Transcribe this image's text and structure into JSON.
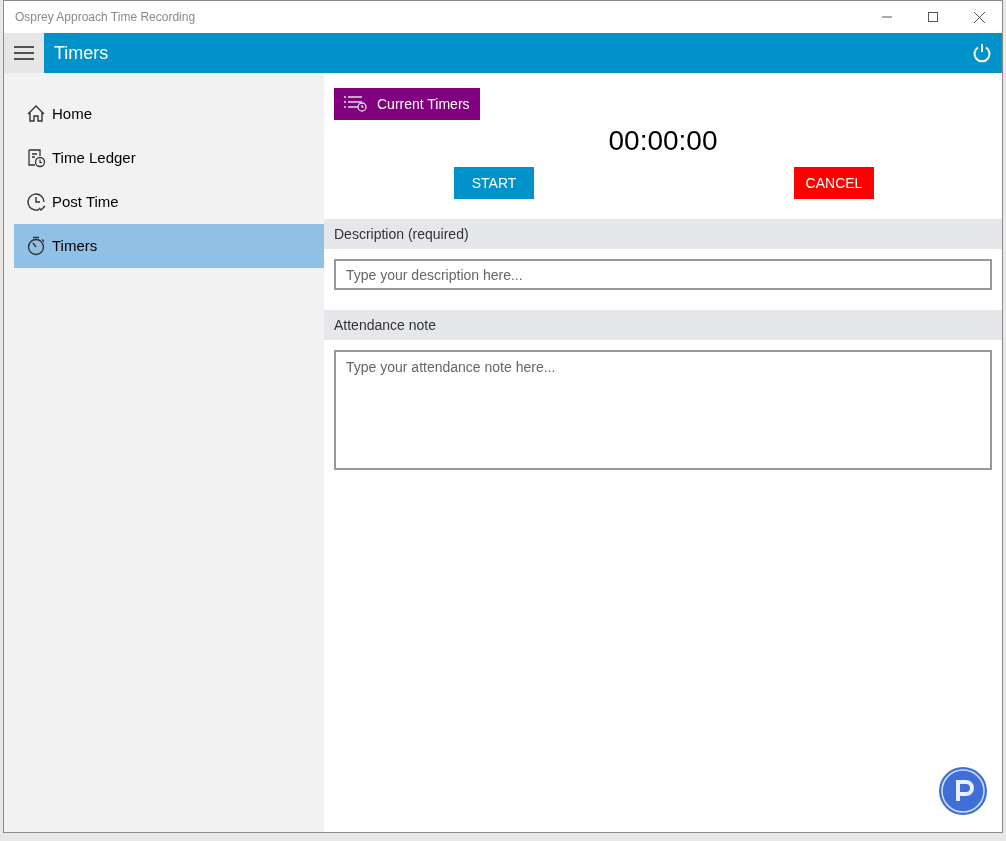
{
  "window": {
    "title": "Osprey Approach Time Recording"
  },
  "header": {
    "title": "Timers"
  },
  "sidebar": {
    "items": [
      {
        "label": "Home",
        "kind": "home",
        "selected": false
      },
      {
        "label": "Time Ledger",
        "kind": "ledger",
        "selected": false
      },
      {
        "label": "Post Time",
        "kind": "post",
        "selected": false
      },
      {
        "label": "Timers",
        "kind": "timer",
        "selected": true
      }
    ]
  },
  "current_timers_button": "Current Timers",
  "timer_display": "00:00:00",
  "buttons": {
    "start": "START",
    "cancel": "CANCEL"
  },
  "description": {
    "label": "Description (required)",
    "placeholder": "Type your description here..."
  },
  "attendance_note": {
    "label": "Attendance note",
    "placeholder": "Type your attendance note here..."
  }
}
